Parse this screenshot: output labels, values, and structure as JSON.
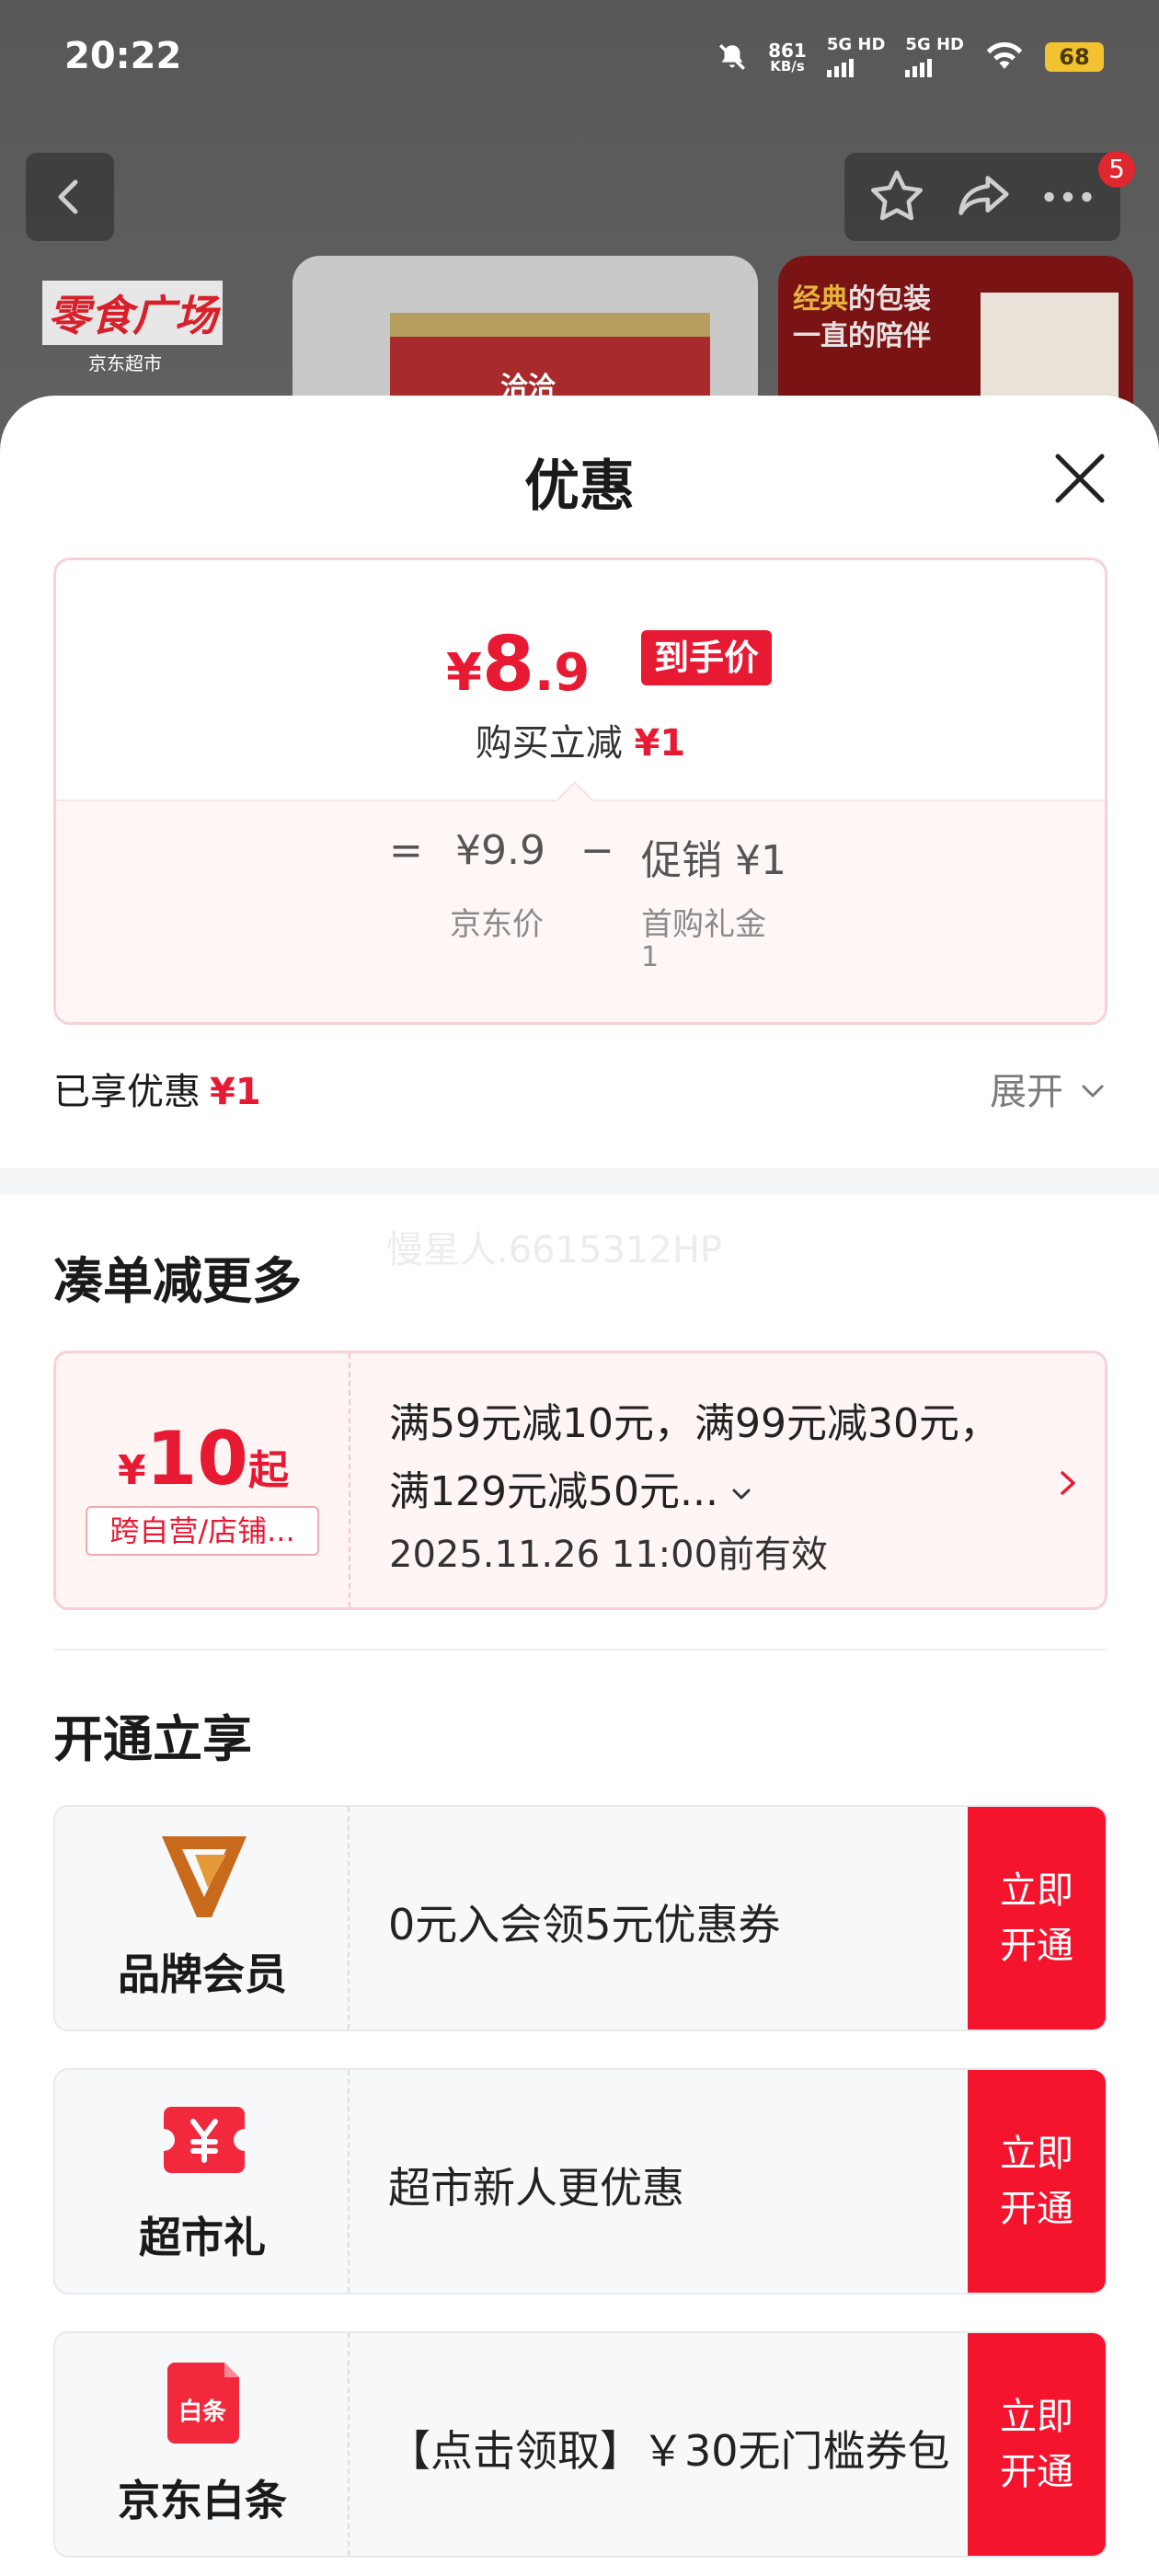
{
  "status_bar": {
    "time": "20:22",
    "net_speed": "861",
    "net_speed_unit": "KB/s",
    "sim1": "5G HD",
    "sim2": "5G HD",
    "battery": "68"
  },
  "background": {
    "nav_badge": "5",
    "promo_title": "零食广场",
    "promo_sub": "京东超市",
    "product_logo": "洽洽",
    "banner_line1_highlight": "经典",
    "banner_line1_rest": "的包装",
    "banner_line2": "一直的陪伴"
  },
  "sheet": {
    "title": "优惠",
    "final_price": {
      "currency": "¥",
      "integer": "8",
      "decimal": ".9",
      "tag": "到手价"
    },
    "reduce_label": "购买立减",
    "reduce_amount": "¥1",
    "calc": {
      "equals": "=",
      "jd_price": "¥9.9",
      "jd_price_label": "京东价",
      "minus": "−",
      "promo": "促销 ¥1",
      "promo_label": "首购礼金",
      "promo_label_value": "1"
    },
    "enjoyed_label": "已享优惠",
    "enjoyed_amount": "¥1",
    "expand_label": "展开",
    "watermark": "慢星人.6615312HP",
    "section_more": "凑单减更多",
    "coupon": {
      "currency": "¥",
      "amount": "10",
      "suffix": "起",
      "scope": "跨自营/店铺...",
      "line1": "满59元减10元，满99元减30元，",
      "line2": "满129元减50元...",
      "valid": "2025.11.26 11:00前有效"
    },
    "section_open": "开通立享",
    "members": [
      {
        "name": "品牌会员",
        "text": "0元入会领5元优惠券",
        "btn1": "立即",
        "btn2": "开通",
        "icon": "brand-v-icon"
      },
      {
        "name": "超市礼",
        "text": "超市新人更优惠",
        "btn1": "立即",
        "btn2": "开通",
        "icon": "yen-ticket-icon"
      },
      {
        "name": "京东白条",
        "text": "【点击领取】￥30无门槛券包",
        "btn1": "立即",
        "btn2": "开通",
        "icon": "baitiao-card-icon",
        "icon_text": "白条"
      }
    ]
  }
}
